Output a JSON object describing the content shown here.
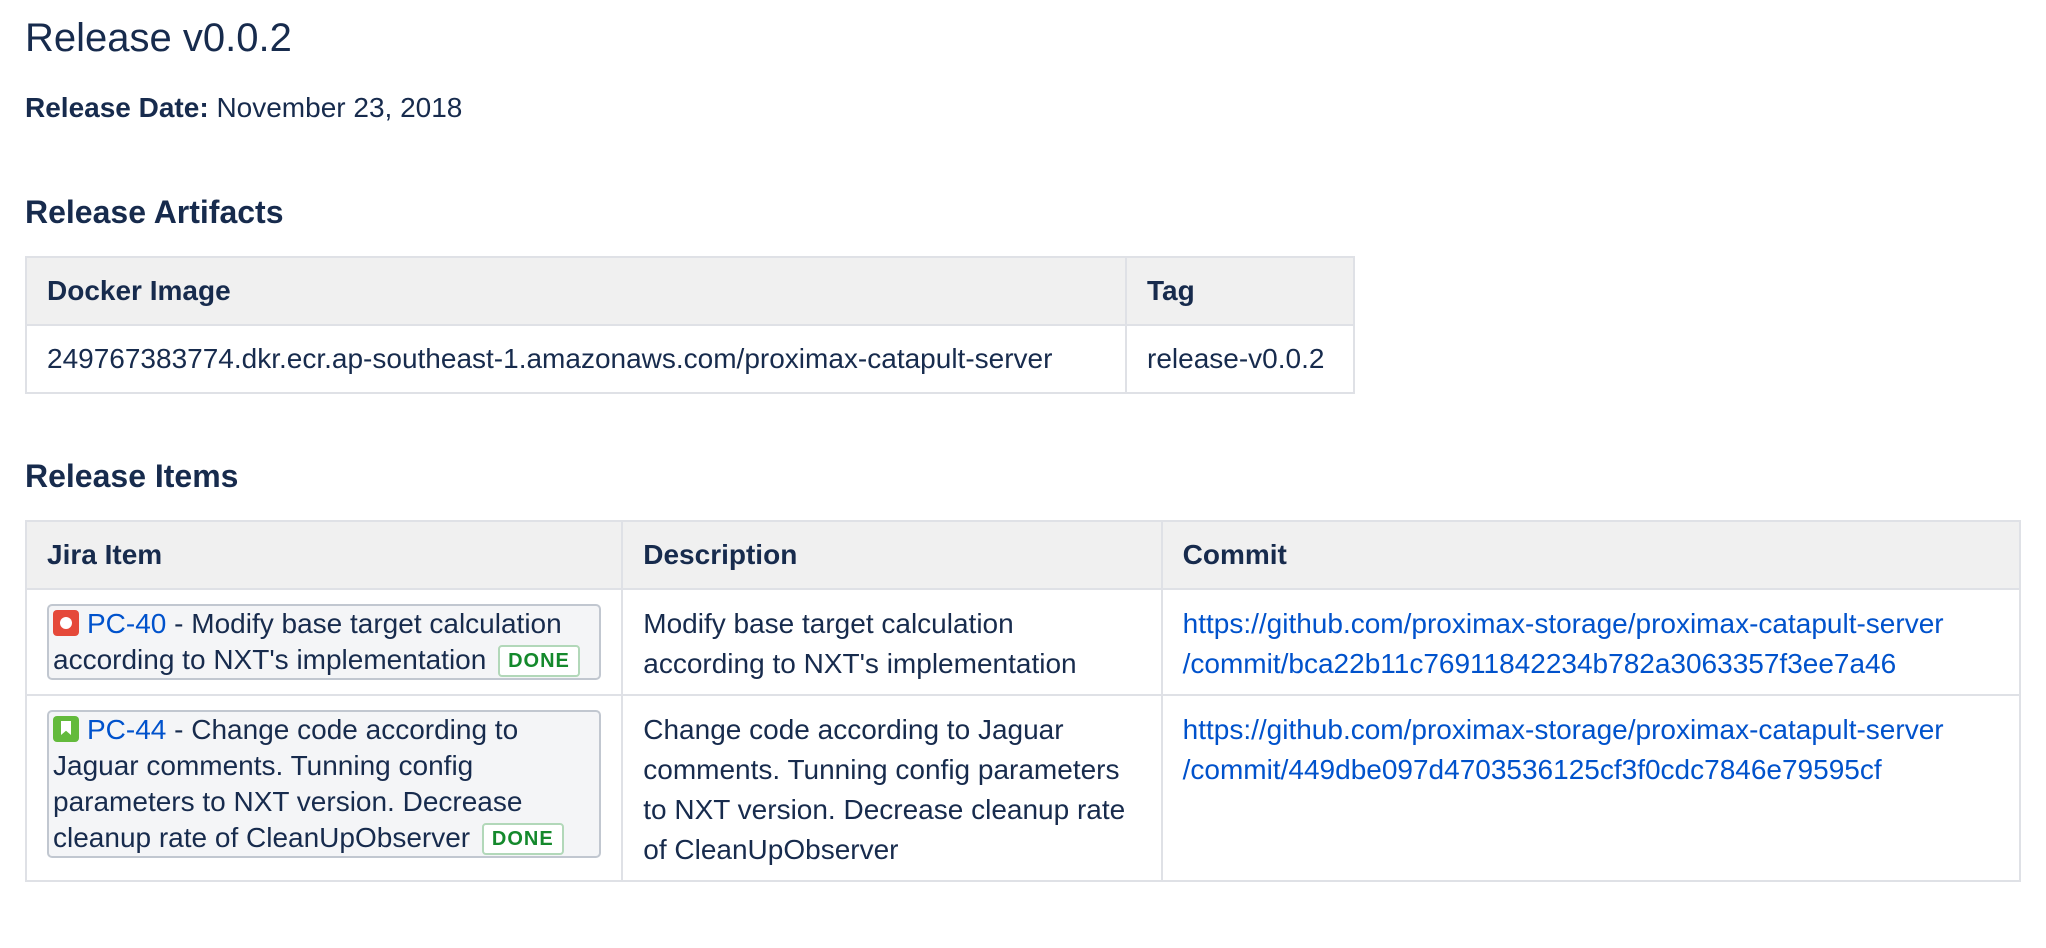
{
  "page": {
    "title": "Release v0.0.2",
    "release_date_label": "Release Date:",
    "release_date_value": "November 23, 2018"
  },
  "artifacts": {
    "heading": "Release Artifacts",
    "columns": [
      "Docker Image",
      "Tag"
    ],
    "rows": [
      {
        "image": "249767383774.dkr.ecr.ap-southeast-1.amazonaws.com/proximax-catapult-server",
        "tag": "release-v0.0.2"
      }
    ]
  },
  "items": {
    "heading": "Release Items",
    "columns": [
      "Jira Item",
      "Description",
      "Commit"
    ],
    "rows": [
      {
        "issue_type": "bug-icon",
        "key": "PC-40",
        "summary": "- Modify base target calculation according to NXT's implementation",
        "status": "DONE",
        "description": "Modify base target calculation according to NXT's implementation",
        "commit_line1": "https://github.com/proximax-storage/proximax-catapult-server",
        "commit_line2": "/commit/bca22b11c76911842234b782a3063357f3ee7a46"
      },
      {
        "issue_type": "story-icon",
        "key": "PC-44",
        "summary": "- Change code according to Jaguar comments. Tunning config parameters to NXT version. Decrease cleanup rate of CleanUpObserver",
        "status": "DONE",
        "description": "Change code according to Jaguar comments. Tunning config parameters to NXT version. Decrease cleanup rate of CleanUpObserver",
        "commit_line1": "https://github.com/proximax-storage/proximax-catapult-server",
        "commit_line2": "/commit/449dbe097d4703536125cf3f0cdc7846e79595cf"
      }
    ]
  },
  "colors": {
    "text": "#172b4d",
    "link": "#0052cc",
    "header_bg": "#f0f0f0",
    "border": "#dfe1e6",
    "done_green": "#14892c",
    "bug_red": "#e5493a",
    "story_green": "#63ba3c"
  }
}
